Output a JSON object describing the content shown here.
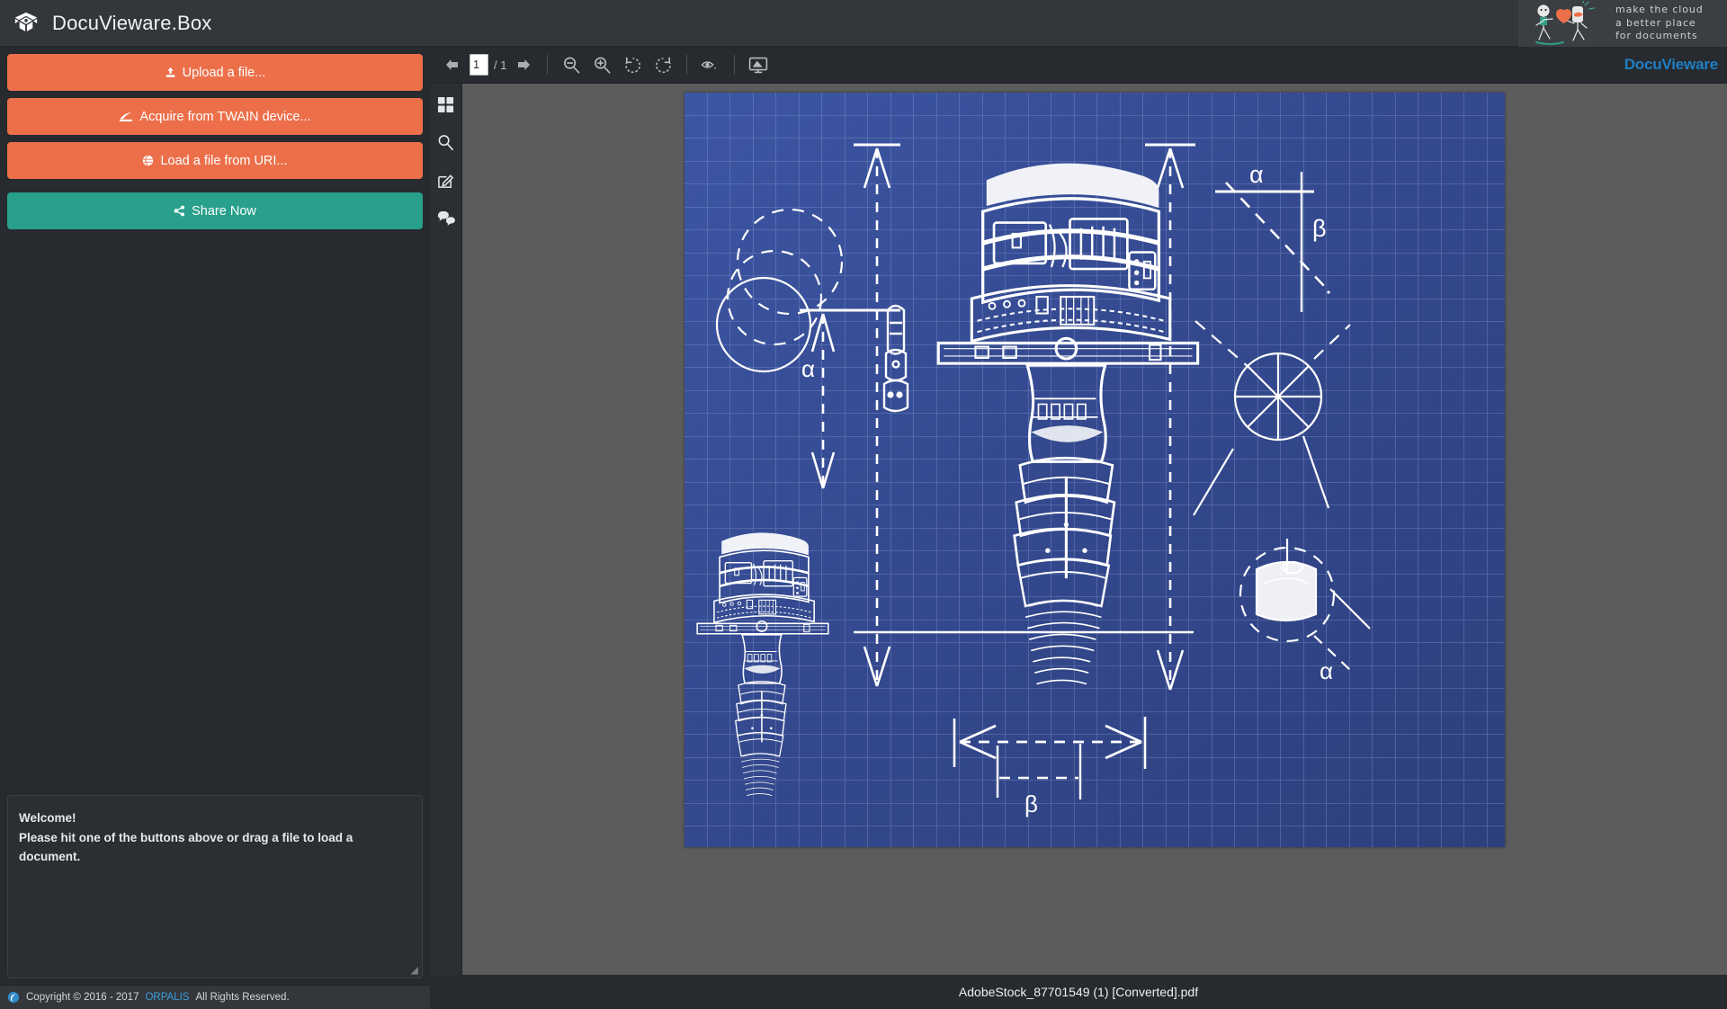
{
  "app": {
    "title": "DocuVieware.Box",
    "logo_icon": "open-box-icon"
  },
  "promo": {
    "line1": "make the cloud",
    "line2": "a better place",
    "line3": "for documents"
  },
  "sidebar": {
    "buttons": [
      {
        "label": "Upload a file...",
        "icon": "upload-icon",
        "color": "#ec6f4a"
      },
      {
        "label": "Acquire from TWAIN device...",
        "icon": "scanner-icon",
        "color": "#ec6f4a"
      },
      {
        "label": "Load a file from URI...",
        "icon": "globe-icon",
        "color": "#ec6f4a"
      },
      {
        "label": "Share Now",
        "icon": "share-icon",
        "color": "#28a08b"
      }
    ]
  },
  "welcome": {
    "title": "Welcome!",
    "message": "Please hit one of the buttons above or drag a file to load a document."
  },
  "footer": {
    "logo_icon": "orpalis-swirl-icon",
    "copyright_prefix": "Copyright © 2016 - 2017",
    "company": "ORPALIS",
    "copyright_suffix": "All Rights Reserved."
  },
  "toolbar": {
    "prev_page_label": "previous-page",
    "next_page_label": "next-page",
    "page_value": "1",
    "page_total": "/ 1",
    "zoom_out_label": "zoom-out",
    "zoom_in_label": "zoom-in",
    "rotate_left_label": "rotate-left",
    "rotate_right_label": "rotate-right",
    "preview_label": "preview-mode",
    "fit_label": "fit-to-screen",
    "brand": "DocuVieware",
    "brand_color": "#1f7fc4"
  },
  "rail": {
    "items": [
      {
        "icon": "thumbnails-grid-icon",
        "name": "thumbnails-panel"
      },
      {
        "icon": "search-icon",
        "name": "search-panel"
      },
      {
        "icon": "annotation-edit-icon",
        "name": "annotations-panel"
      },
      {
        "icon": "comments-bubbles-icon",
        "name": "comments-panel"
      }
    ]
  },
  "document": {
    "filename": "AdobeStock_87701549 (1) [Converted].pdf",
    "page_background": "#34498f",
    "ink_color": "#ffffff",
    "annotations": {
      "alpha_top_right": "α",
      "beta_top_right": "β",
      "alpha_left": "α",
      "alpha_bottom_right": "α",
      "beta_bottom": "β"
    }
  }
}
